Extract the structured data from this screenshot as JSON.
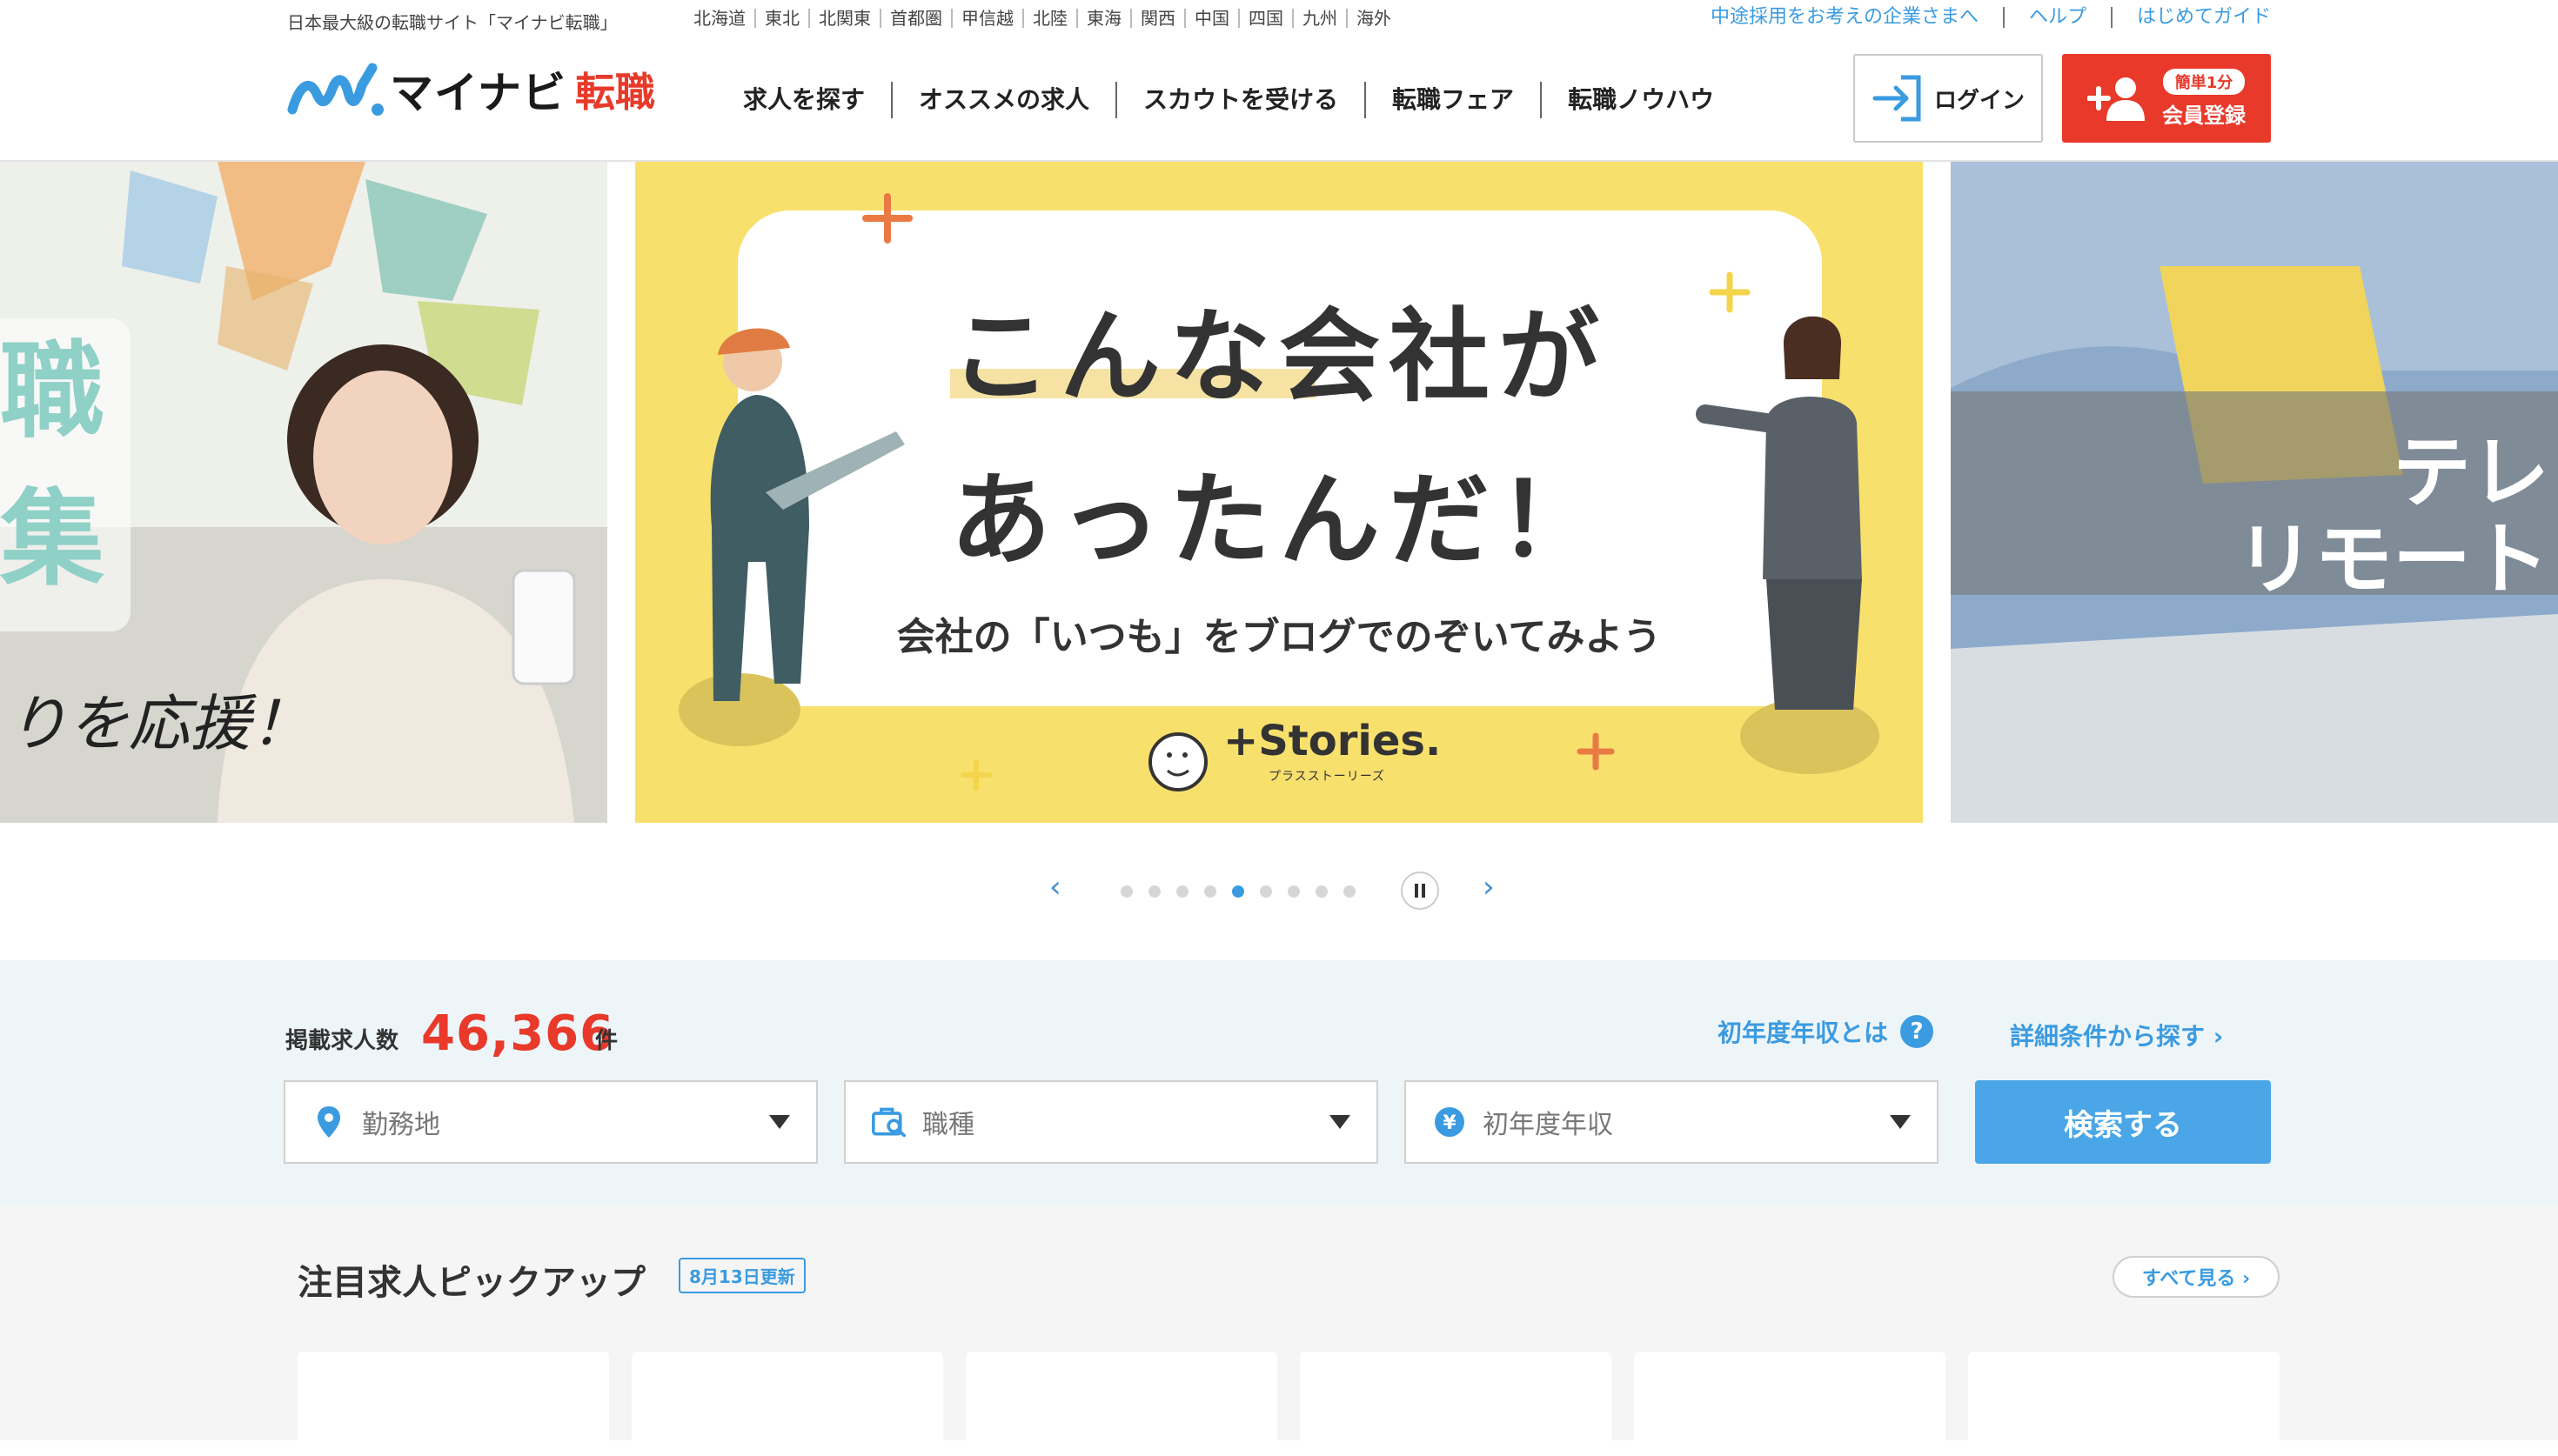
{
  "topbar": {
    "tagline": "日本最大級の転職サイト「マイナビ転職」",
    "regions": [
      "北海道",
      "東北",
      "北関東",
      "首都圏",
      "甲信越",
      "北陸",
      "東海",
      "関西",
      "中国",
      "四国",
      "九州",
      "海外"
    ],
    "links": [
      "中途採用をお考えの企業さまへ",
      "ヘルプ",
      "はじめてガイド"
    ]
  },
  "header": {
    "logo_text": "マイナビ",
    "logo_accent": "転職",
    "nav": [
      "求人を探す",
      "オススメの求人",
      "スカウトを受ける",
      "転職フェア",
      "転職ノウハウ"
    ],
    "login_label": "ログイン",
    "register_badge": "簡単1分",
    "register_label": "会員登録",
    "accent_color": "#e8392a",
    "link_color": "#3a9be0"
  },
  "carousel": {
    "left_kanji": [
      "職",
      "集"
    ],
    "left_script": "りを応援！",
    "headline_line1": "こんな会社が",
    "headline_line2": "あったんだ！",
    "subline": "会社の「いつも」をブログでのぞいてみよう",
    "brand_main": "+Stories.",
    "brand_sub": "プラスストーリーズ",
    "right_text1": "テレ",
    "right_text2": "リモート",
    "dot_count": 9,
    "active_dot": 5,
    "prev_icon": "chevron-left-icon",
    "next_icon": "chevron-right-icon"
  },
  "search": {
    "count_label": "掲載求人数",
    "count_value": "46,366",
    "count_unit": "件",
    "help_label": "初年度年収とは",
    "detail_label": "詳細条件から探す ›",
    "fields": [
      {
        "icon": "location-pin-icon",
        "placeholder": "勤務地"
      },
      {
        "icon": "job-search-icon",
        "placeholder": "職種"
      },
      {
        "icon": "yen-icon",
        "placeholder": "初年度年収"
      }
    ],
    "search_button": "検索する"
  },
  "pickup": {
    "title": "注目求人ピックアップ",
    "badge": "8月13日更新",
    "see_all": "すべて見る ›"
  }
}
